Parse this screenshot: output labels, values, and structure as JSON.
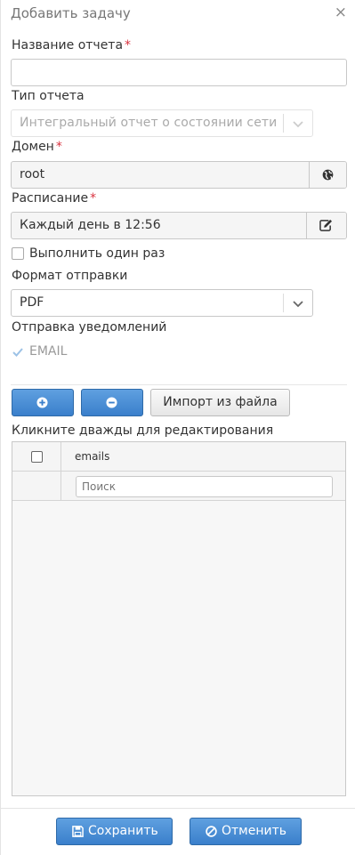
{
  "dialog": {
    "title": "Добавить задачу",
    "close": "×"
  },
  "form": {
    "report_name": {
      "label": "Название отчета",
      "required_mark": "*",
      "value": ""
    },
    "report_type": {
      "label": "Тип отчета",
      "value": "Интегральный отчет о состоянии сети"
    },
    "domain": {
      "label": "Домен",
      "required_mark": "*",
      "value": "root"
    },
    "schedule": {
      "label": "Расписание",
      "required_mark": "*",
      "value": "Каждый день в 12:56"
    },
    "run_once": {
      "label": "Выполнить один раз",
      "checked": false
    },
    "send_format": {
      "label": "Формат отправки",
      "value": "PDF"
    },
    "notifications": {
      "label": "Отправка уведомлений",
      "email_label": "EMAIL",
      "email_checked": true
    }
  },
  "toolbar": {
    "import_label": "Импорт из файла"
  },
  "grid": {
    "hint": "Кликните дважды для редактирования",
    "columns": [
      "emails"
    ],
    "filter_placeholder": "Поиск",
    "rows": []
  },
  "footer": {
    "save_label": "Сохранить",
    "cancel_label": "Отменить"
  },
  "colors": {
    "accent": "#3a7fcb",
    "required": "#d9323f"
  }
}
